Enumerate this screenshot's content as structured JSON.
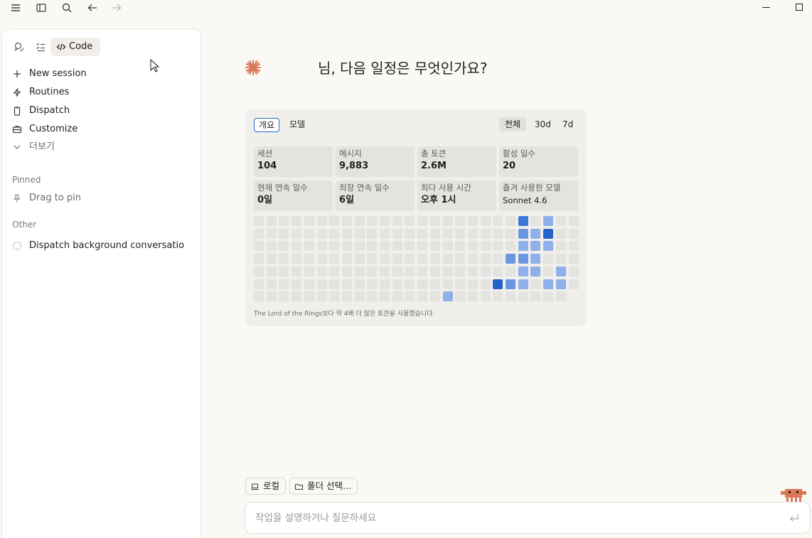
{
  "topbar": {
    "icons": [
      "menu-icon",
      "sidebar-toggle-icon",
      "search-icon",
      "back-arrow-icon",
      "forward-arrow-icon"
    ]
  },
  "sidebar": {
    "mode_tab": "Code",
    "nav": [
      {
        "label": "New session",
        "icon": "plus-icon"
      },
      {
        "label": "Routines",
        "icon": "bolt-icon"
      },
      {
        "label": "Dispatch",
        "icon": "phone-icon"
      },
      {
        "label": "Customize",
        "icon": "briefcase-icon"
      },
      {
        "label": "더보기",
        "icon": "chevron-down-icon"
      }
    ],
    "pinned_label": "Pinned",
    "pinned_hint": "Drag to pin",
    "other_label": "Other",
    "other_items": [
      "Dispatch background conversatio"
    ]
  },
  "main": {
    "greeting": "님, 다음 일정은 무엇인가요?",
    "accent_color": "#d97757"
  },
  "stats_card": {
    "tabs": [
      "개요",
      "모델"
    ],
    "active_tab": "개요",
    "ranges": [
      "전체",
      "30d",
      "7d"
    ],
    "active_range": "전체",
    "stats": [
      {
        "label": "세션",
        "value": "104"
      },
      {
        "label": "메시지",
        "value": "9,883"
      },
      {
        "label": "총 토큰",
        "value": "2.6M"
      },
      {
        "label": "활성 일수",
        "value": "20"
      },
      {
        "label": "현재 연속 일수",
        "value": "0일"
      },
      {
        "label": "최장 연속 일수",
        "value": "6일"
      },
      {
        "label": "최다 사용 시간",
        "value": "오후 1시"
      },
      {
        "label": "즐겨 사용한 모델",
        "value": "Sonnet 4.6"
      }
    ],
    "heatmap": {
      "columns": 26,
      "rows": 7,
      "levels_colors": [
        "#e4e3df",
        "#8fb0e8",
        "#6a96e0",
        "#3d78d8",
        "#2563c8"
      ],
      "active_cells": [
        {
          "col": 21,
          "row": 0,
          "level": 3
        },
        {
          "col": 23,
          "row": 0,
          "level": 1
        },
        {
          "col": 21,
          "row": 1,
          "level": 2
        },
        {
          "col": 22,
          "row": 1,
          "level": 1
        },
        {
          "col": 23,
          "row": 1,
          "level": 4
        },
        {
          "col": 21,
          "row": 2,
          "level": 1
        },
        {
          "col": 22,
          "row": 2,
          "level": 1
        },
        {
          "col": 23,
          "row": 2,
          "level": 1
        },
        {
          "col": 20,
          "row": 3,
          "level": 2
        },
        {
          "col": 21,
          "row": 3,
          "level": 2
        },
        {
          "col": 22,
          "row": 3,
          "level": 1
        },
        {
          "col": 21,
          "row": 4,
          "level": 1
        },
        {
          "col": 22,
          "row": 4,
          "level": 1
        },
        {
          "col": 24,
          "row": 4,
          "level": 1
        },
        {
          "col": 19,
          "row": 5,
          "level": 4
        },
        {
          "col": 20,
          "row": 5,
          "level": 2
        },
        {
          "col": 21,
          "row": 5,
          "level": 1
        },
        {
          "col": 23,
          "row": 5,
          "level": 1
        },
        {
          "col": 24,
          "row": 5,
          "level": 1
        },
        {
          "col": 15,
          "row": 6,
          "level": 1
        }
      ]
    },
    "note": "The Lord of the Rings보다 약 4배 더 많은 토큰을 사용했습니다."
  },
  "bottom": {
    "chip_local": "로컬",
    "chip_folder": "폴더 선택...",
    "prompt_placeholder": "작업을 설명하거나 질문하세요"
  }
}
